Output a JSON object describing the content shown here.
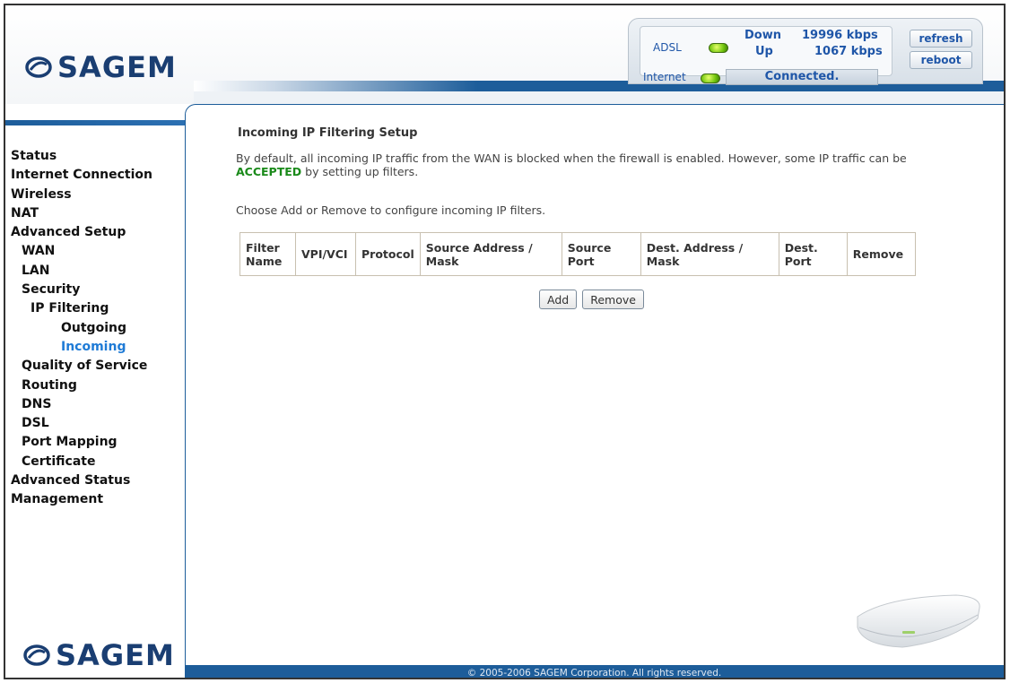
{
  "brand": {
    "name": "SAGEM"
  },
  "status": {
    "adsl_label": "ADSL",
    "internet_label": "Internet",
    "down_label": "Down",
    "up_label": "Up",
    "down_speed": "19996 kbps",
    "up_speed": "1067 kbps",
    "connection": "Connected.",
    "refresh_label": "refresh",
    "reboot_label": "reboot",
    "led_color": "#6fc40c"
  },
  "sidebar": {
    "items": [
      {
        "label": "Status",
        "level": 0
      },
      {
        "label": "Internet Connection",
        "level": 0
      },
      {
        "label": "Wireless",
        "level": 0
      },
      {
        "label": "NAT",
        "level": 0
      },
      {
        "label": "Advanced Setup",
        "level": 0
      },
      {
        "label": "WAN",
        "level": 1
      },
      {
        "label": "LAN",
        "level": 1
      },
      {
        "label": "Security",
        "level": 1
      },
      {
        "label": "IP Filtering",
        "level": 2
      },
      {
        "label": "Outgoing",
        "level": 3
      },
      {
        "label": "Incoming",
        "level": 3,
        "active": true
      },
      {
        "label": "Quality of Service",
        "level": 1
      },
      {
        "label": "Routing",
        "level": 1
      },
      {
        "label": "DNS",
        "level": 1
      },
      {
        "label": "DSL",
        "level": 1
      },
      {
        "label": "Port Mapping",
        "level": 1
      },
      {
        "label": "Certificate",
        "level": 1
      },
      {
        "label": "Advanced Status",
        "level": 0
      },
      {
        "label": "Management",
        "level": 0
      }
    ]
  },
  "main": {
    "title": "Incoming IP Filtering Setup",
    "desc_part1": "By default, all incoming IP traffic from the WAN is blocked when the firewall is enabled. However, some IP traffic can be",
    "desc_accepted": "ACCEPTED",
    "desc_part2": "by setting up filters.",
    "choose_text": "Choose Add or Remove to configure incoming IP filters.",
    "table_headers": [
      "Filter Name",
      "VPI/VCI",
      "Protocol",
      "Source Address / Mask",
      "Source Port",
      "Dest. Address / Mask",
      "Dest. Port",
      "Remove"
    ],
    "add_label": "Add",
    "remove_label": "Remove"
  },
  "footer": {
    "copyright": "© 2005-2006 SAGEM Corporation. All rights reserved."
  },
  "colors": {
    "brand_blue": "#1d5d9a",
    "link_active": "#1f7bd6",
    "accepted_green": "#1a8a1a"
  }
}
